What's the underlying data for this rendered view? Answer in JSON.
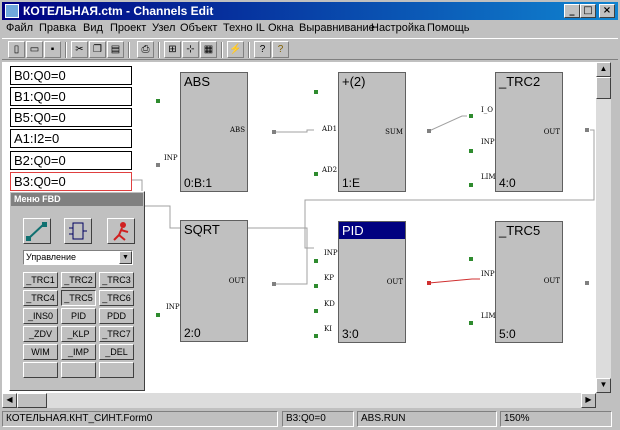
{
  "window": {
    "title": "КОТЕЛЬНАЯ.ctm - Channels Edit",
    "minimize_glyph": "_",
    "maximize_glyph": "□",
    "close_glyph": "×"
  },
  "menu": [
    "Файл",
    "Правка",
    "Вид",
    "Проект",
    "Узел",
    "Объект",
    "Техно IL",
    "Окна",
    "Выравнивание",
    "Настройка",
    "Помощь"
  ],
  "toolbar": [
    {
      "name": "new-icon",
      "glyph": "▯"
    },
    {
      "name": "open-icon",
      "glyph": "▭"
    },
    {
      "name": "save-icon",
      "glyph": "▪"
    },
    {
      "name": "cut-icon",
      "glyph": "✂"
    },
    {
      "name": "copy-icon",
      "glyph": "❐"
    },
    {
      "name": "paste-icon",
      "glyph": "▤"
    },
    {
      "name": "print-icon",
      "glyph": "⎙"
    },
    {
      "name": "align-icon",
      "glyph": "⊞"
    },
    {
      "name": "tree-icon",
      "glyph": "⊹"
    },
    {
      "name": "grid-icon",
      "glyph": "▦"
    },
    {
      "name": "run-icon",
      "glyph": "⚡"
    },
    {
      "name": "context-help-icon",
      "glyph": "?"
    },
    {
      "name": "help-icon",
      "glyph": "?"
    }
  ],
  "variables": [
    "B0:Q0=0",
    "B1:Q0=0",
    "B5:Q0=0",
    "A1:I2=0",
    "B2:Q0=0",
    "B3:Q0=0"
  ],
  "blocks": [
    {
      "id": "abs",
      "title": "ABS",
      "footer": "0:B:1",
      "inputs": [],
      "outputs": [
        "ABS"
      ]
    },
    {
      "id": "add",
      "title": "+(2)",
      "footer": "1:E",
      "inputs": [
        "AD1",
        "AD2"
      ],
      "outputs": [
        "SUM"
      ]
    },
    {
      "id": "trc2",
      "title": "_TRC2",
      "footer": "4:0",
      "inputs": [
        "I_O",
        "INP",
        "LIM"
      ],
      "outputs": [
        "OUT"
      ]
    },
    {
      "id": "sqrt",
      "title": "SQRT",
      "footer": "2:0",
      "inputs": [
        "INP"
      ],
      "outputs": [
        "OUT"
      ]
    },
    {
      "id": "pid",
      "title": "PID",
      "footer": "3:0",
      "inputs": [
        "INP",
        "KP",
        "KD",
        "KI"
      ],
      "outputs": [
        "OUT"
      ]
    },
    {
      "id": "trc5",
      "title": "_TRC5",
      "footer": "5:0",
      "inputs": [
        "INP",
        "LIM"
      ],
      "outputs": [
        "OUT"
      ]
    }
  ],
  "abs_input_label": "INP",
  "palette": {
    "title": "Меню FBD",
    "category": "Управление",
    "buttons": [
      "_TRC1",
      "_TRC2",
      "_TRC3",
      "_TRC4",
      "_TRC5",
      "_TRC6",
      "_INS0",
      "PID",
      "PDD",
      "_ZDV",
      "_KLP",
      "_TRC7",
      "WIM",
      "_IMP",
      "_DEL",
      "",
      "",
      ""
    ],
    "selected_button": "_TRC5"
  },
  "status": {
    "path": "КОТЕЛЬНАЯ.КНТ_СИНТ.Form0",
    "variable": "B3:Q0=0",
    "block_state": "ABS.RUN",
    "zoom": "150%"
  },
  "colors": {
    "title_start": "#000080",
    "pin_in": "#2e8b2e",
    "link": "#a0a0a0",
    "selected_link": "#d03030",
    "selected_block": "#000080"
  }
}
